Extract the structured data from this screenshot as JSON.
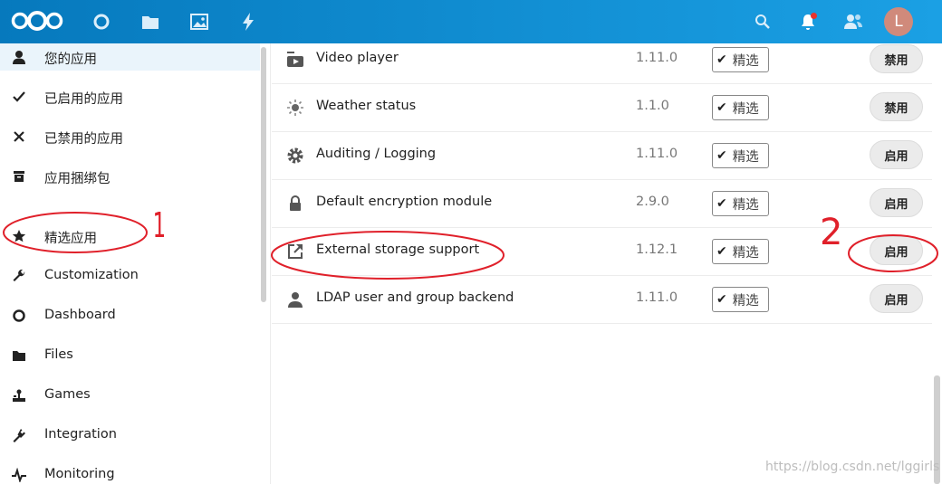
{
  "header": {
    "avatar_letter": "L",
    "icons": [
      "nextcloud-logo",
      "dashboard-icon",
      "files-icon",
      "photos-icon",
      "activity-icon",
      "search-icon",
      "notifications-icon",
      "contacts-icon"
    ],
    "brand_color": "#0082c9"
  },
  "sidebar": {
    "items": [
      {
        "label": "您的应用",
        "icon": "user-icon"
      },
      {
        "label": "已启用的应用",
        "icon": "check-icon"
      },
      {
        "label": "已禁用的应用",
        "icon": "close-icon"
      },
      {
        "label": "应用捆绑包",
        "icon": "bundle-icon"
      },
      {
        "label": "精选应用",
        "icon": "star-icon"
      },
      {
        "label": "Customization",
        "icon": "wrench-icon"
      },
      {
        "label": "Dashboard",
        "icon": "circle-icon"
      },
      {
        "label": "Files",
        "icon": "folder-icon"
      },
      {
        "label": "Games",
        "icon": "joystick-icon"
      },
      {
        "label": "Integration",
        "icon": "plug-icon"
      },
      {
        "label": "Monitoring",
        "icon": "pulse-icon"
      }
    ]
  },
  "apps": [
    {
      "name": "Video player",
      "version": "1.11.0",
      "badge": "精选",
      "action": "禁用",
      "icon": "video-icon"
    },
    {
      "name": "Weather status",
      "version": "1.1.0",
      "badge": "精选",
      "action": "禁用",
      "icon": "sun-icon"
    },
    {
      "name": "Auditing / Logging",
      "version": "1.11.0",
      "badge": "精选",
      "action": "启用",
      "icon": "gear-icon"
    },
    {
      "name": "Default encryption module",
      "version": "2.9.0",
      "badge": "精选",
      "action": "启用",
      "icon": "lock-icon"
    },
    {
      "name": "External storage support",
      "version": "1.12.1",
      "badge": "精选",
      "action": "启用",
      "icon": "external-link-icon"
    },
    {
      "name": "LDAP user and group backend",
      "version": "1.11.0",
      "badge": "精选",
      "action": "启用",
      "icon": "user-icon"
    }
  ],
  "annotations": {
    "marker_1": "1",
    "marker_2": "2",
    "color": "#e0202a"
  },
  "watermark": "https://blog.csdn.net/lggirls"
}
